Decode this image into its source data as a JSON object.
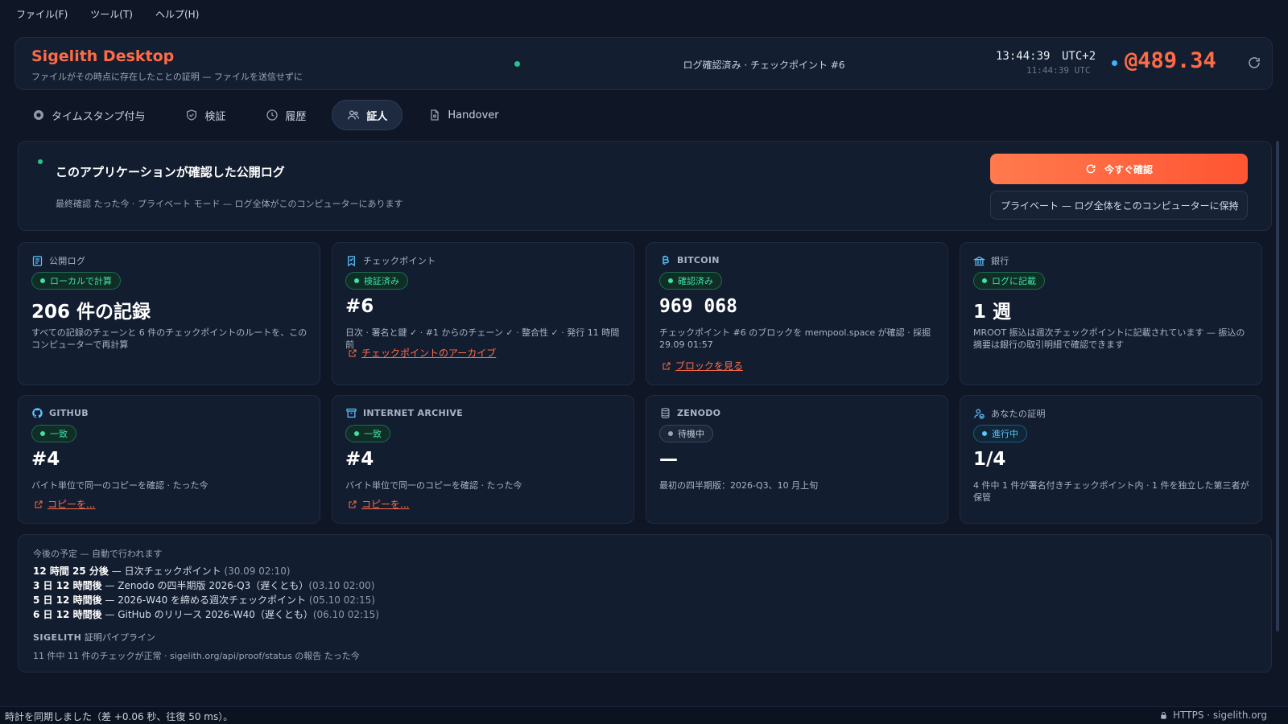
{
  "menu": [
    "ファイル(F)",
    "ツール(T)",
    "ヘルプ(H)"
  ],
  "header": {
    "title": "Sigelith Desktop",
    "subtitle": "ファイルがその時点に存在したことの証明 — ファイルを送信せずに",
    "status": "ログ確認済み · チェックポイント #6",
    "time": "13:44:39",
    "tz": "UTC+2",
    "utc_time": "11:44:39 UTC",
    "balance": "@489.34"
  },
  "tabs": [
    {
      "label": "タイムスタンプ付与",
      "icon": "stamp-icon"
    },
    {
      "label": "検証",
      "icon": "shield-icon"
    },
    {
      "label": "履歴",
      "icon": "clock-icon"
    },
    {
      "label": "証人",
      "icon": "users-icon",
      "active": true
    },
    {
      "label": "Handover",
      "icon": "file-icon"
    }
  ],
  "hero": {
    "title": "このアプリケーションが確認した公開ログ",
    "subtitle": "最終確認 たった今 · プライベート モード — ログ全体がこのコンピューターにあります",
    "button": "今すぐ確認",
    "select": "プライベート — ログ全体をこのコンピューターに保持"
  },
  "cards": [
    {
      "title": "公開ログ",
      "badge": "ローカルで計算",
      "value": "206 件の記録",
      "desc": "すべての記録のチェーンと 6 件のチェックポイントのルートを、このコンピューターで再計算",
      "link": ""
    },
    {
      "title": "チェックポイント",
      "badge": "検証済み",
      "value": "#6",
      "desc": "日次 · 署名と鍵 ✓ · #1 からのチェーン ✓ · 整合性 ✓ · 発行 11 時間前",
      "link": "チェックポイントのアーカイブ"
    },
    {
      "title": "BITCOIN",
      "badge": "確認済み",
      "value": "969 068",
      "desc": "チェックポイント #6 のブロックを mempool.space が確認 · 採掘 29.09 01:57",
      "link": "ブロックを見る"
    },
    {
      "title": "銀行",
      "badge": "ログに記載",
      "value": "1 週",
      "desc": "MROOT 振込は週次チェックポイントに記載されています — 振込の摘要は銀行の取引明細で確認できます",
      "link": ""
    },
    {
      "title": "GITHUB",
      "badge": "一致",
      "value": "#4",
      "desc": "バイト単位で同一のコピーを確認 · たった今",
      "link": "コピーを..."
    },
    {
      "title": "INTERNET ARCHIVE",
      "badge": "一致",
      "value": "#4",
      "desc": "バイト単位で同一のコピーを確認 · たった今",
      "link": "コピーを..."
    },
    {
      "title": "ZENODO",
      "badge": "待機中",
      "value": "—",
      "desc": "最初の四半期版：2026-Q3、10 月上旬",
      "link": ""
    },
    {
      "title": "あなたの証明",
      "badge": "進行中",
      "value": "1/4",
      "desc": "4 件中 1 件が署名付きチェックポイント内 · 1 件を独立した第三者が保管",
      "link": ""
    }
  ],
  "schedule": {
    "title": "今後の予定 — 自動で行われます",
    "items": [
      {
        "when": "12 時間 25 分後",
        "what": " — 日次チェックポイント ",
        "date": "(30.09 02:10)"
      },
      {
        "when": "3 日 12 時間後",
        "what": " — Zenodo の四半期版 2026-Q3（遅くとも）",
        "date": "(03.10 02:00)"
      },
      {
        "when": "5 日 12 時間後",
        "what": " — 2026-W40 を締める週次チェックポイント ",
        "date": "(05.10 02:15)"
      },
      {
        "when": "6 日 12 時間後",
        "what": " — GitHub のリリース 2026-W40（遅くとも）",
        "date": "(06.10 02:15)"
      }
    ],
    "pipeline_brand": "SIGELITH",
    "pipeline_title": "証明パイプライン",
    "pipeline_desc": "11 件中 11 件のチェックが正常 · sigelith.org/api/proof/status の報告 たった今"
  },
  "statusbar": {
    "left": "時計を同期しました（差 +0.06 秒、往復 50 ms）。",
    "right": "HTTPS · sigelith.org"
  }
}
